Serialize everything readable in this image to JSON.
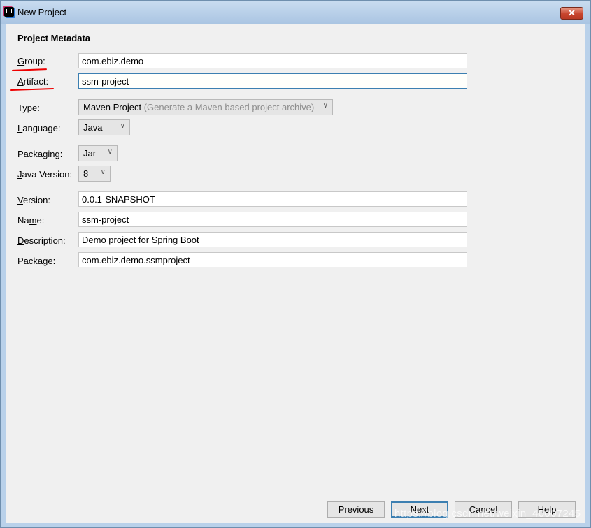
{
  "window": {
    "title": "New Project",
    "close_label": "✕"
  },
  "section_title": "Project Metadata",
  "fields": {
    "group": {
      "label_u": "G",
      "label_rest": "roup:",
      "value": "com.ebiz.demo"
    },
    "artifact": {
      "label_u": "A",
      "label_rest": "rtifact:",
      "value": "ssm-project"
    },
    "type": {
      "label_u": "T",
      "label_rest": "ype:",
      "value": "Maven Project",
      "hint": "(Generate a Maven based project archive)"
    },
    "language": {
      "label_u": "L",
      "label_rest": "anguage:",
      "value": "Java"
    },
    "packaging": {
      "label_pre": "Packa",
      "label_u": "g",
      "label_rest": "ing:",
      "value": "Jar"
    },
    "java_version": {
      "label_u": "J",
      "label_rest": "ava Version:",
      "value": "8"
    },
    "version": {
      "label_u": "V",
      "label_rest": "ersion:",
      "value": "0.0.1-SNAPSHOT"
    },
    "name": {
      "label_pre": "Na",
      "label_u": "m",
      "label_rest": "e:",
      "value": "ssm-project"
    },
    "description": {
      "label_u": "D",
      "label_rest": "escription:",
      "value": "Demo project for Spring Boot"
    },
    "package": {
      "label_pre": "Pac",
      "label_u": "k",
      "label_rest": "age:",
      "value": "com.ebiz.demo.ssmproject"
    }
  },
  "buttons": {
    "previous": "Previous",
    "next": "Next",
    "cancel": "Cancel",
    "help": "Help"
  },
  "watermark": "https://blog.csdn.net/weixin_40007245",
  "colors": {
    "focus_border": "#3c7fb1",
    "annotation_red": "#e00000",
    "close_red": "#c7452e"
  }
}
